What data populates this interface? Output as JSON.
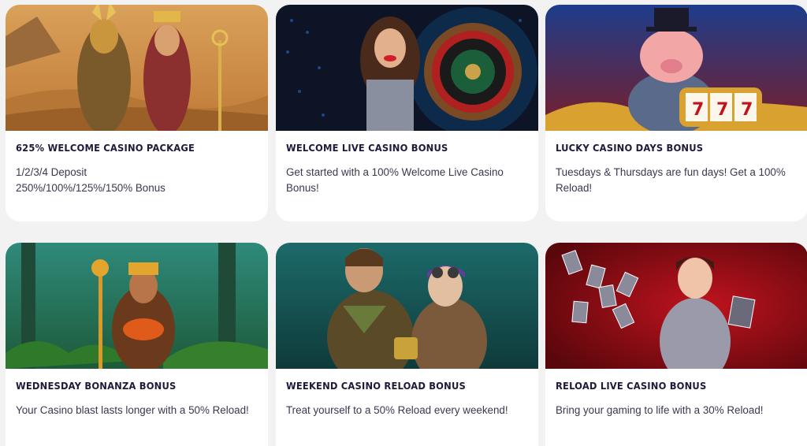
{
  "promotions": [
    {
      "title": "625% Welcome Casino Package",
      "lines": [
        "1/2/3/4 Deposit",
        "250%/100%/125%/150% Bonus"
      ]
    },
    {
      "title": "Welcome Live Casino Bonus",
      "lines": [
        "Get started with a 100% Welcome Live Casino",
        "Bonus!"
      ]
    },
    {
      "title": "Lucky Casino Days Bonus",
      "lines": [
        "Tuesdays & Thursdays are fun days! Get a 100%",
        "Reload!"
      ]
    },
    {
      "title": "Wednesday Bonanza Bonus",
      "lines": [
        "Your Casino blast lasts longer with a 50% Reload!"
      ]
    },
    {
      "title": "Weekend Casino Reload Bonus",
      "lines": [
        "Treat yourself to a 50% Reload every weekend!"
      ]
    },
    {
      "title": "Reload Live Casino Bonus",
      "lines": [
        "Bring your gaming to life with a 30% Reload!"
      ]
    }
  ],
  "colors": {
    "page_bg": "#f2f2f2",
    "card_bg": "#ffffff",
    "title": "#1e1b3a",
    "text": "#3a3850"
  }
}
